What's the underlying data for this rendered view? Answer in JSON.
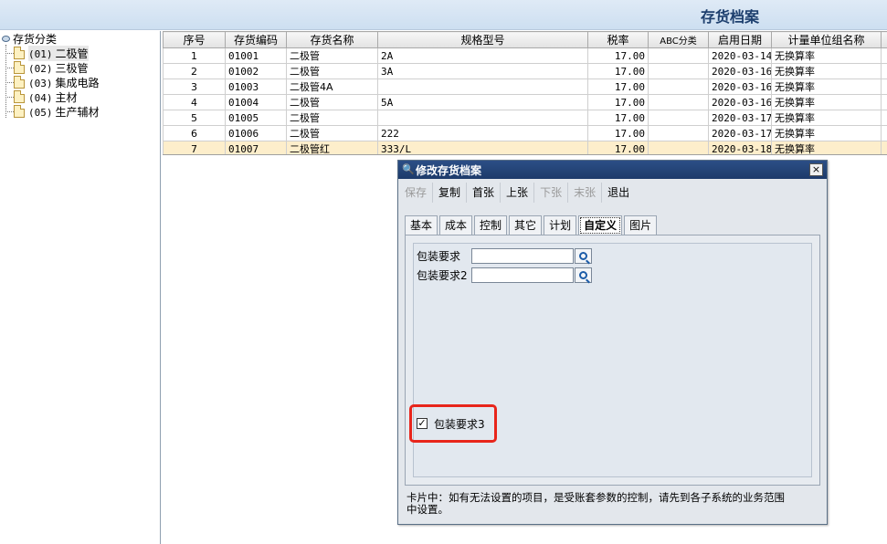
{
  "window": {
    "title": "存货档案"
  },
  "tree": {
    "root": "存货分类",
    "items": [
      {
        "code": "(01)",
        "name": "二极管",
        "selected": true
      },
      {
        "code": "(02)",
        "name": "三极管"
      },
      {
        "code": "(03)",
        "name": "集成电路"
      },
      {
        "code": "(04)",
        "name": "主材"
      },
      {
        "code": "(05)",
        "name": "生产辅材"
      }
    ]
  },
  "grid": {
    "columns": [
      "序号",
      "存货编码",
      "存货名称",
      "规格型号",
      "税率",
      "ABC分类",
      "启用日期",
      "计量单位组名称"
    ],
    "rows": [
      {
        "no": "1",
        "code": "01001",
        "name": "二极管",
        "spec": "2A",
        "tax": "17.00",
        "abc": "",
        "date": "2020-03-14",
        "unit": "无换算率"
      },
      {
        "no": "2",
        "code": "01002",
        "name": "二极管",
        "spec": "3A",
        "tax": "17.00",
        "abc": "",
        "date": "2020-03-16",
        "unit": "无换算率"
      },
      {
        "no": "3",
        "code": "01003",
        "name": "二极管4A",
        "spec": "",
        "tax": "17.00",
        "abc": "",
        "date": "2020-03-16",
        "unit": "无换算率"
      },
      {
        "no": "4",
        "code": "01004",
        "name": "二极管",
        "spec": "5A",
        "tax": "17.00",
        "abc": "",
        "date": "2020-03-16",
        "unit": "无换算率"
      },
      {
        "no": "5",
        "code": "01005",
        "name": "二极管",
        "spec": "",
        "tax": "17.00",
        "abc": "",
        "date": "2020-03-17",
        "unit": "无换算率"
      },
      {
        "no": "6",
        "code": "01006",
        "name": "二极管",
        "spec": "222",
        "tax": "17.00",
        "abc": "",
        "date": "2020-03-17",
        "unit": "无换算率"
      },
      {
        "no": "7",
        "code": "01007",
        "name": "二极管红",
        "spec": "333/L",
        "tax": "17.00",
        "abc": "",
        "date": "2020-03-18",
        "unit": "无换算率"
      }
    ]
  },
  "dialog": {
    "title": "修改存货档案",
    "close": "×",
    "toolbar": [
      {
        "label": "保存",
        "enabled": false
      },
      {
        "label": "复制",
        "enabled": true
      },
      {
        "label": "首张",
        "enabled": true
      },
      {
        "label": "上张",
        "enabled": true
      },
      {
        "label": "下张",
        "enabled": false
      },
      {
        "label": "末张",
        "enabled": false
      },
      {
        "label": "退出",
        "enabled": true
      }
    ],
    "tabs": [
      "基本",
      "成本",
      "控制",
      "其它",
      "计划",
      "自定义",
      "图片"
    ],
    "active_tab": "自定义",
    "fields": [
      {
        "label": "包装要求",
        "value": ""
      },
      {
        "label": "包装要求2",
        "value": ""
      }
    ],
    "checkbox": {
      "label": "包装要求3",
      "checked": true,
      "mark": "✓"
    },
    "note": "卡片中：如有无法设置的项目，是受账套参数的控制，请先到各子系统的业务范围中设置。"
  }
}
